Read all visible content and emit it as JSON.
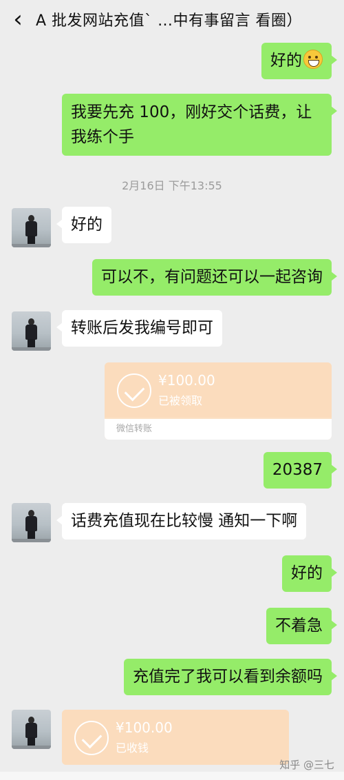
{
  "header": {
    "back_icon": "chevron-left-icon",
    "title": "A 批发网站充值ˋ …中有事留言 看圈）"
  },
  "messages": {
    "m1": "好的",
    "m1_emoji": "grinning-face-emoji",
    "m2": "我要先充 100，刚好交个话费，让我练个手",
    "timestamp": "2月16日 下午13:55",
    "m3": "好的",
    "m4": "可以不，有问题还可以一起咨询",
    "m5": "转账后发我编号即可",
    "m6": "20387",
    "m7": "话费充值现在比较慢 通知一下啊",
    "m8": "好的",
    "m9": "不着急",
    "m10": "充值完了我可以看到余额吗"
  },
  "transfer1": {
    "amount": "¥100.00",
    "status": "已被领取",
    "footer": "微信转账"
  },
  "transfer2": {
    "amount": "¥100.00",
    "status": "已收钱"
  },
  "watermark": "知乎 @三七",
  "colors": {
    "background": "#ededed",
    "my_bubble": "#95ec69",
    "their_bubble": "#ffffff",
    "transfer": "#fbdcbd"
  }
}
